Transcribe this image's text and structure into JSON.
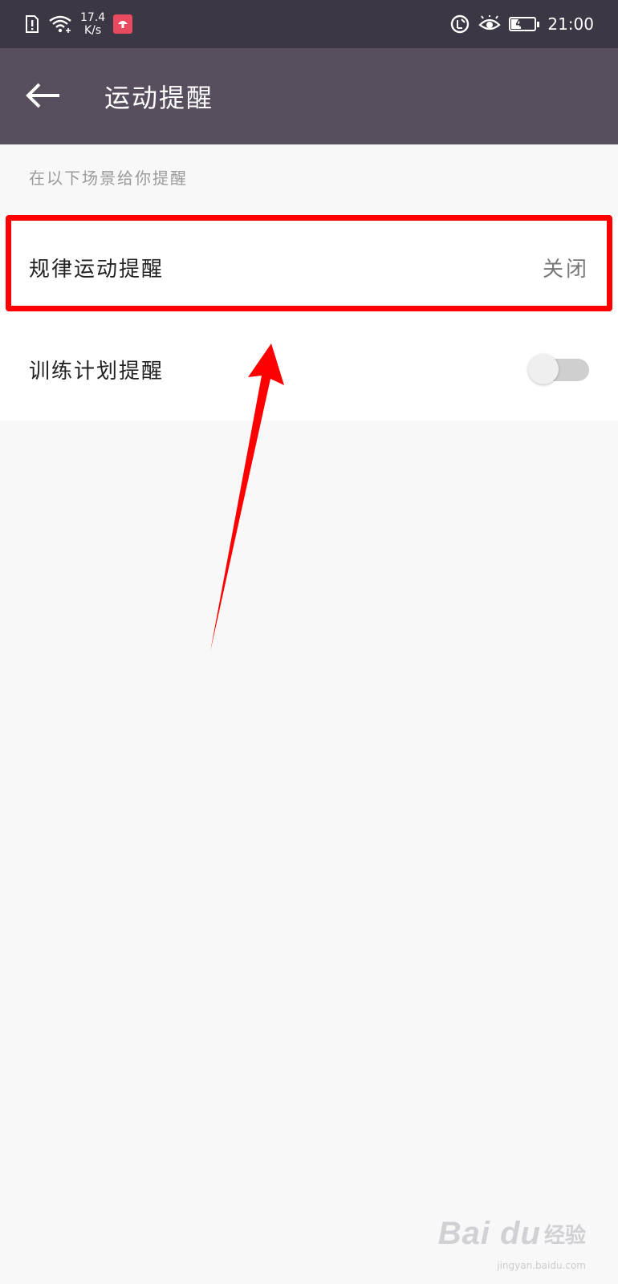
{
  "status_bar": {
    "net_speed_value": "17.4",
    "net_speed_unit": "K/s",
    "battery_level": "41",
    "battery_fraction": 0.41,
    "time": "21:00",
    "icons": [
      "sim-alert-icon",
      "wifi-icon",
      "app-notification-icon",
      "data-saver-icon",
      "eye-comfort-icon",
      "battery-icon"
    ]
  },
  "app_bar": {
    "title": "运动提醒",
    "back_icon": "arrow-left-icon"
  },
  "section": {
    "caption": "在以下场景给你提醒"
  },
  "settings": [
    {
      "label": "规律运动提醒",
      "value": "关闭",
      "type": "link"
    },
    {
      "label": "训练计划提醒",
      "type": "toggle",
      "enabled": false
    }
  ],
  "annotation": {
    "highlight_color": "#ff0000",
    "arrow_color": "#ff0000"
  },
  "watermark": {
    "logo": "Bai du",
    "text": "经验",
    "url": "jingyan.baidu.com"
  },
  "colors": {
    "status_bar_bg": "#3c3744",
    "app_bar_bg": "#574e5e",
    "page_bg": "#f8f8f8"
  }
}
